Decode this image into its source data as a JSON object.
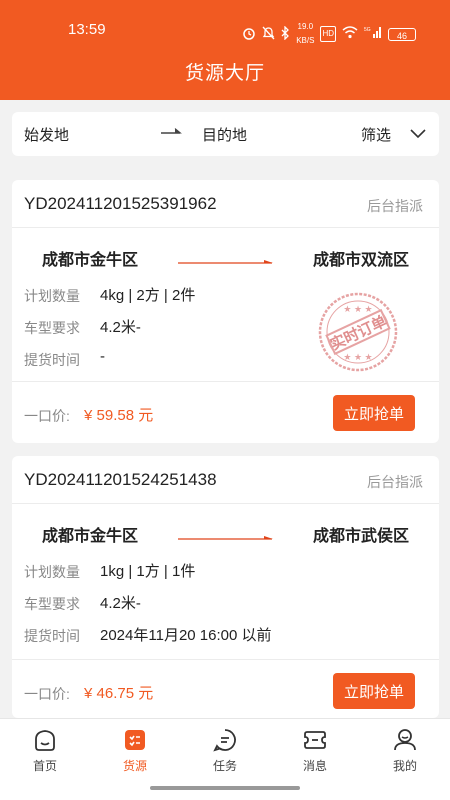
{
  "status_bar": {
    "time": "13:59",
    "network_speed": "19.0",
    "network_unit": "KB/S",
    "hd": "HD",
    "signal": "5G",
    "battery": "46"
  },
  "header": {
    "title": "货源大厅"
  },
  "filter": {
    "origin": "始发地",
    "destination": "目的地",
    "screen_label": "筛选"
  },
  "colors": {
    "accent": "#f15a22",
    "muted": "#888888",
    "stamp": "#e0a0a0"
  },
  "orders": [
    {
      "order_no": "YD20241120152539196​2",
      "tag": "后台指派",
      "from": "成都市金牛区",
      "to": "成都市双流区",
      "rows": [
        {
          "label": "计划数量",
          "value": "4kg | 2方 | 2件"
        },
        {
          "label": "车型要求",
          "value": "4.2米-"
        },
        {
          "label": "提货时间",
          "value": "-"
        }
      ],
      "price_label": "一口价:",
      "price": "¥ 59.58 元",
      "action": "立即抢单",
      "stamp_text": "实时订单"
    },
    {
      "order_no": "YD20241120152425143​8",
      "tag": "后台指派",
      "from": "成都市金牛区",
      "to": "成都市武侯区",
      "rows": [
        {
          "label": "计划数量",
          "value": "1kg | 1方 | 1件"
        },
        {
          "label": "车型要求",
          "value": "4.2米-"
        },
        {
          "label": "提货时间",
          "value": "2024年11月20 16:00 以前"
        }
      ],
      "price_label": "一口价:",
      "price": "¥ 46.75 元",
      "action": "立即抢单"
    }
  ],
  "tabbar": [
    {
      "label": "首页",
      "icon": "home-icon"
    },
    {
      "label": "货源",
      "icon": "cargo-icon",
      "active": true
    },
    {
      "label": "任务",
      "icon": "task-icon"
    },
    {
      "label": "消息",
      "icon": "message-icon"
    },
    {
      "label": "我的",
      "icon": "profile-icon"
    }
  ]
}
